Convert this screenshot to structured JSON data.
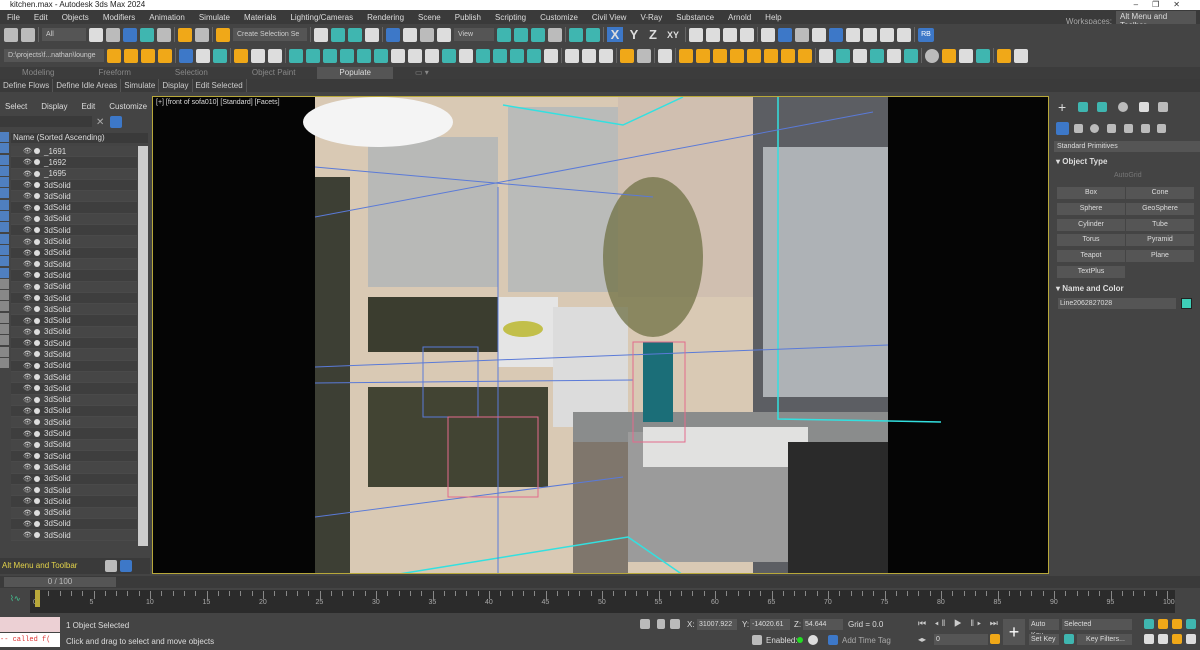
{
  "window": {
    "title": "kitchen.max - Autodesk 3ds Max 2024",
    "controls": [
      "–",
      "❐",
      "✕"
    ]
  },
  "menu": [
    "File",
    "Edit",
    "Objects",
    "Modifiers",
    "Animation",
    "Simulate",
    "Materials",
    "Lighting/Cameras",
    "Rendering",
    "Scene",
    "Publish",
    "Scripting",
    "Customize",
    "Civil View",
    "V-Ray",
    "Substance",
    "Arnold",
    "Help"
  ],
  "workspaces": {
    "label": "Workspaces:",
    "value": "Alt Menu and Toolbar"
  },
  "toolbar": {
    "filter": "All",
    "selection_set": "Create Selection Se",
    "ref_coord": "View",
    "axes": [
      "X",
      "Y",
      "Z",
      "XY"
    ],
    "rb_label": "RB",
    "path": "D:\\projects\\f...nathan\\lounge"
  },
  "ribbon": {
    "tabs": [
      "Modeling",
      "Freeform",
      "Selection",
      "Object Paint",
      "Populate"
    ],
    "active": "Populate",
    "buttons": [
      "Define Flows",
      "Define Idle Areas",
      "Simulate",
      "Display",
      "Edit Selected"
    ]
  },
  "explorer": {
    "tabs": [
      "Select",
      "Display",
      "Edit",
      "Customize"
    ],
    "column": "Name (Sorted Ascending)",
    "items": [
      "_1691",
      "_1692",
      "_1695",
      "3dSolid",
      "3dSolid",
      "3dSolid",
      "3dSolid",
      "3dSolid",
      "3dSolid",
      "3dSolid",
      "3dSolid",
      "3dSolid",
      "3dSolid",
      "3dSolid",
      "3dSolid",
      "3dSolid",
      "3dSolid",
      "3dSolid",
      "3dSolid",
      "3dSolid",
      "3dSolid",
      "3dSolid",
      "3dSolid",
      "3dSolid",
      "3dSolid",
      "3dSolid",
      "3dSolid",
      "3dSolid",
      "3dSolid",
      "3dSolid",
      "3dSolid",
      "3dSolid",
      "3dSolid",
      "3dSolid",
      "3dSolid"
    ],
    "workspace": "Alt Menu and Toolbar"
  },
  "viewport": {
    "label": "[+] [front of sofa010] [Standard] [Facets]"
  },
  "command_panel": {
    "category": "Standard Primitives",
    "object_type": "Object Type",
    "autogrid": "AutoGrid",
    "buttons": [
      "Box",
      "Cone",
      "Sphere",
      "GeoSphere",
      "Cylinder",
      "Tube",
      "Torus",
      "Pyramid",
      "Teapot",
      "Plane",
      "TextPlus"
    ],
    "name_color": "Name and Color",
    "object_name": "Line2062827028",
    "object_color": "#3ecfb8"
  },
  "timeline": {
    "frame": "0 / 100",
    "ticks": [
      "0",
      "5",
      "10",
      "15",
      "20",
      "25",
      "30",
      "35",
      "40",
      "45",
      "50",
      "55",
      "60",
      "65",
      "70",
      "75",
      "80",
      "85",
      "90",
      "95",
      "100"
    ]
  },
  "status": {
    "script": "-- called f(",
    "selected": "1 Object Selected",
    "prompt": "Click and drag to select and move objects",
    "x_label": "X:",
    "x": "31007.922",
    "y_label": "Y:",
    "y": "-14020.61",
    "z_label": "Z:",
    "z": "54.644",
    "grid": "Grid = 0.0",
    "enabled": "Enabled:",
    "add_time_tag": "Add Time Tag",
    "frame_field": "0",
    "auto_key": "Auto Key",
    "set_key": "Set Key",
    "key_mode": "Selected",
    "key_filters": "Key Filters..."
  }
}
